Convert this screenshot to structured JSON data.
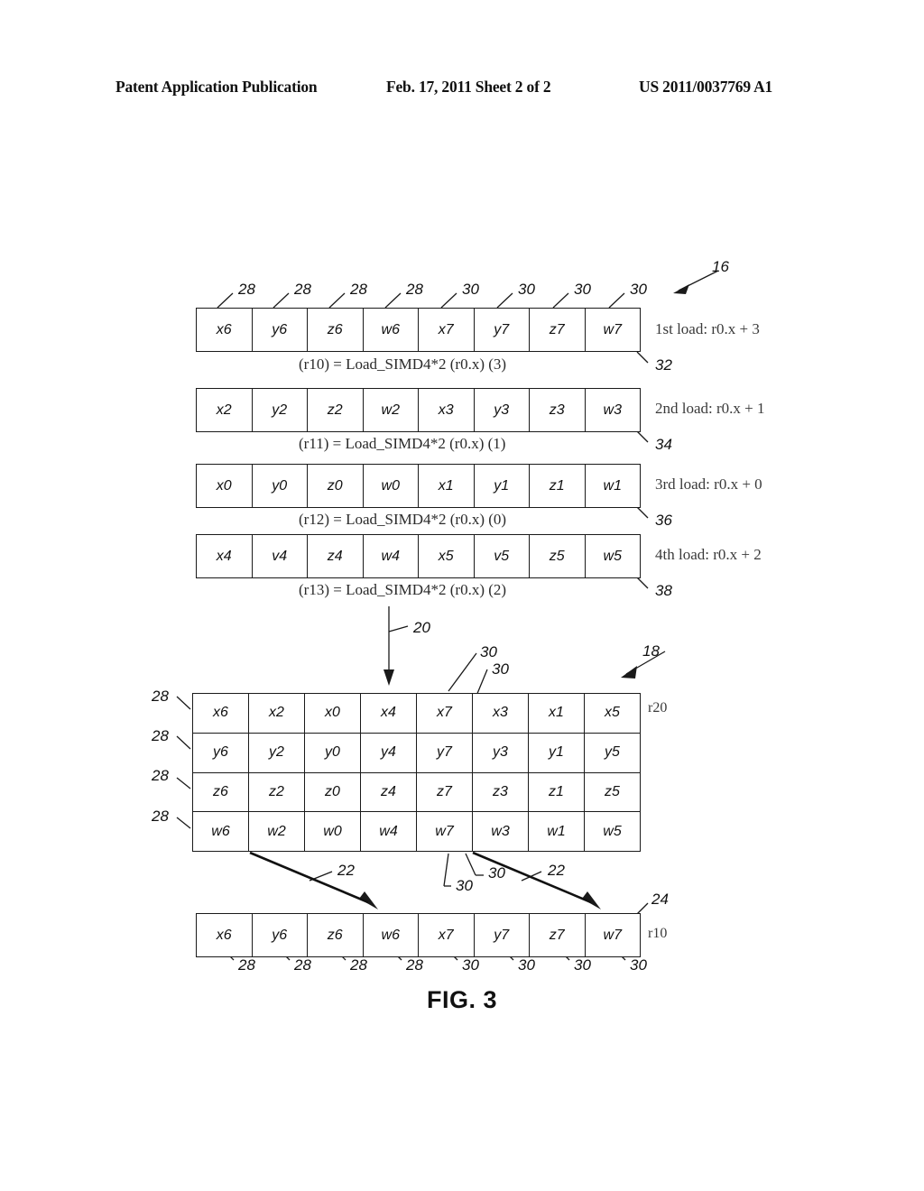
{
  "header": {
    "left": "Patent Application Publication",
    "middle": "Feb. 17, 2011  Sheet 2 of 2",
    "right": "US 2011/0037769 A1"
  },
  "figure": {
    "caption": "FIG. 3",
    "group_refs": {
      "loads_group": "16",
      "matrix_group": "18",
      "transform_arrow": "20",
      "extract_arrow": "22",
      "result_row": "24"
    },
    "element_refs": {
      "even_component": "28",
      "odd_component": "30"
    }
  },
  "loads": {
    "rows": [
      {
        "ref": "32",
        "side_label": "1st load: r0.x + 3",
        "caption": "(r10) = Load_SIMD4*2 (r0.x) (3)",
        "cells": [
          "x6",
          "y6",
          "z6",
          "w6",
          "x7",
          "y7",
          "z7",
          "w7"
        ],
        "top_refs": [
          "28",
          "28",
          "28",
          "28",
          "30",
          "30",
          "30",
          "30"
        ]
      },
      {
        "ref": "34",
        "side_label": "2nd load: r0.x + 1",
        "caption": "(r11) = Load_SIMD4*2 (r0.x) (1)",
        "cells": [
          "x2",
          "y2",
          "z2",
          "w2",
          "x3",
          "y3",
          "z3",
          "w3"
        ]
      },
      {
        "ref": "36",
        "side_label": "3rd load: r0.x + 0",
        "caption": "(r12) = Load_SIMD4*2 (r0.x) (0)",
        "cells": [
          "x0",
          "y0",
          "z0",
          "w0",
          "x1",
          "y1",
          "z1",
          "w1"
        ]
      },
      {
        "ref": "38",
        "side_label": "4th load: r0.x + 2",
        "caption": "(r13) = Load_SIMD4*2 (r0.x) (2)",
        "cells": [
          "x4",
          "v4",
          "z4",
          "w4",
          "x5",
          "v5",
          "z5",
          "w5"
        ]
      }
    ]
  },
  "matrix": {
    "register_label": "r20",
    "left_refs": [
      "28",
      "28",
      "28",
      "28"
    ],
    "top_refs": [
      "30",
      "30"
    ],
    "rows": [
      [
        "x6",
        "x2",
        "x0",
        "x4",
        "x7",
        "x3",
        "x1",
        "x5"
      ],
      [
        "y6",
        "y2",
        "y0",
        "y4",
        "y7",
        "y3",
        "y1",
        "y5"
      ],
      [
        "z6",
        "z2",
        "z0",
        "z4",
        "z7",
        "z3",
        "z1",
        "z5"
      ],
      [
        "w6",
        "w2",
        "w0",
        "w4",
        "w7",
        "w3",
        "w1",
        "w5"
      ]
    ]
  },
  "result": {
    "ref": "24",
    "register_label": "r10",
    "cells": [
      "x6",
      "y6",
      "z6",
      "w6",
      "x7",
      "y7",
      "z7",
      "w7"
    ],
    "bottom_refs": [
      "28",
      "28",
      "28",
      "28",
      "30",
      "30",
      "30",
      "30"
    ],
    "arrow_refs": [
      "22",
      "22"
    ],
    "mid_refs": [
      "30",
      "30"
    ]
  }
}
